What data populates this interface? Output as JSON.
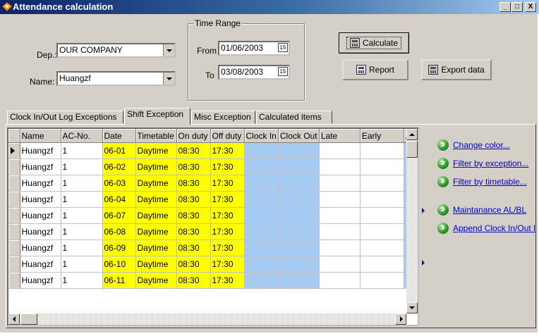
{
  "window": {
    "title": "Attendance calculation",
    "min": "_",
    "max": "□",
    "close": "X"
  },
  "filters": {
    "dep_label": "Dep.:",
    "dep_value": "OUR COMPANY",
    "name_label": "Name:",
    "name_value": "Huangzf",
    "time_range_label": "Time Range",
    "from_label": "From",
    "from_value": "01/06/2003",
    "to_label": "To",
    "to_value": "03/08/2003",
    "cal_glyph": "15"
  },
  "buttons": {
    "calculate": "Calculate",
    "report": "Report",
    "export": "Export data"
  },
  "tabs": [
    "Clock In/Out Log Exceptions",
    "Shift Exception",
    "Misc Exception",
    "Calculated items"
  ],
  "active_tab": 1,
  "grid": {
    "columns": [
      "Name",
      "AC-No.",
      "Date",
      "Timetable",
      "On duty",
      "Off duty",
      "Clock In",
      "Clock Out",
      "Late",
      "Early",
      "A"
    ],
    "rows": [
      [
        "Huangzf",
        "1",
        "06-01",
        "Daytime",
        "08:30",
        "17:30"
      ],
      [
        "Huangzf",
        "1",
        "06-02",
        "Daytime",
        "08:30",
        "17:30"
      ],
      [
        "Huangzf",
        "1",
        "06-03",
        "Daytime",
        "08:30",
        "17:30"
      ],
      [
        "Huangzf",
        "1",
        "06-04",
        "Daytime",
        "08:30",
        "17:30"
      ],
      [
        "Huangzf",
        "1",
        "06-07",
        "Daytime",
        "08:30",
        "17:30"
      ],
      [
        "Huangzf",
        "1",
        "06-08",
        "Daytime",
        "08:30",
        "17:30"
      ],
      [
        "Huangzf",
        "1",
        "06-09",
        "Daytime",
        "08:30",
        "17:30"
      ],
      [
        "Huangzf",
        "1",
        "06-10",
        "Daytime",
        "08:30",
        "17:30"
      ],
      [
        "Huangzf",
        "1",
        "06-11",
        "Daytime",
        "08:30",
        "17:30"
      ]
    ],
    "highlight_yellow": "#ffff00",
    "highlight_blue": "#a6caf0"
  },
  "side_links": [
    "Change color...",
    "Filter by exception...",
    "Filter by timetable...",
    "Maintanance AL/BL",
    "Append Clock In/Out l"
  ]
}
